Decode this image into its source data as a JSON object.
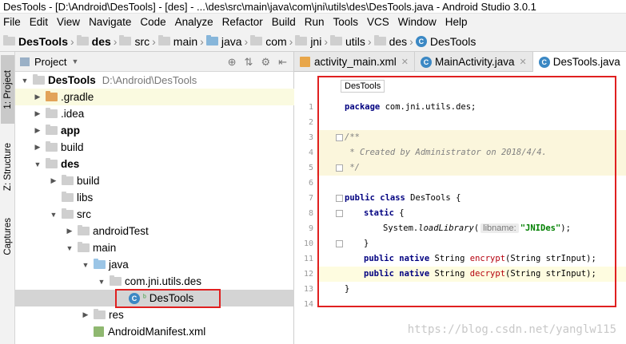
{
  "window": {
    "title": "DesTools - [D:\\Android\\DesTools] - [des] - ...\\des\\src\\main\\java\\com\\jni\\utils\\des\\DesTools.java - Android Studio 3.0.1"
  },
  "menu": [
    "File",
    "Edit",
    "View",
    "Navigate",
    "Code",
    "Analyze",
    "Refactor",
    "Build",
    "Run",
    "Tools",
    "VCS",
    "Window",
    "Help"
  ],
  "breadcrumb": [
    "DesTools",
    "des",
    "src",
    "main",
    "java",
    "com",
    "jni",
    "utils",
    "des",
    "DesTools"
  ],
  "left_tools": {
    "project": "1: Project",
    "structure": "Z: Structure",
    "captures": "Captures"
  },
  "project_panel": {
    "title": "Project",
    "root": {
      "name": "DesTools",
      "path": "D:\\Android\\DesTools"
    },
    "items": [
      ".gradle",
      ".idea",
      "app",
      "build",
      "des",
      "build",
      "libs",
      "src",
      "androidTest",
      "main",
      "java",
      "com.jni.utils.des",
      "DesTools",
      "res",
      "AndroidManifest.xml"
    ]
  },
  "editor": {
    "tabs": [
      "activity_main.xml",
      "MainActivity.java",
      "DesTools.java"
    ],
    "breadcrumb_popup": "DesTools",
    "lines": [
      "1",
      "2",
      "3",
      "4",
      "5",
      "6",
      "7",
      "8",
      "9",
      "10",
      "11",
      "12",
      "13",
      "14"
    ],
    "code": {
      "pkg_kw": "package",
      "pkg_name": " com.jni.utils.des;",
      "c1": "/**",
      "c2": " * Created by Administrator on 2018/4/4.",
      "c3": " */",
      "cls_kw": "public class",
      "cls_name": " DesTools {",
      "static_kw": "static",
      "static_rest": " {",
      "sys": "System.",
      "load": "loadLibrary",
      "paren": "(",
      "hint": "libname:",
      "lib": "\"JNIDes\"",
      "end": ");",
      "close1": "}",
      "m_kw": "public native",
      "m_type": " String ",
      "enc": "encrypt",
      "dec": "decrypt",
      "m_args": "(String strInput);",
      "close2": "}"
    }
  },
  "watermark": "https://blog.csdn.net/yanglw115",
  "colors": {
    "highlight_box": "#e02020",
    "keyword": "#000080",
    "string": "#008000",
    "method_name": "#b5000d"
  }
}
